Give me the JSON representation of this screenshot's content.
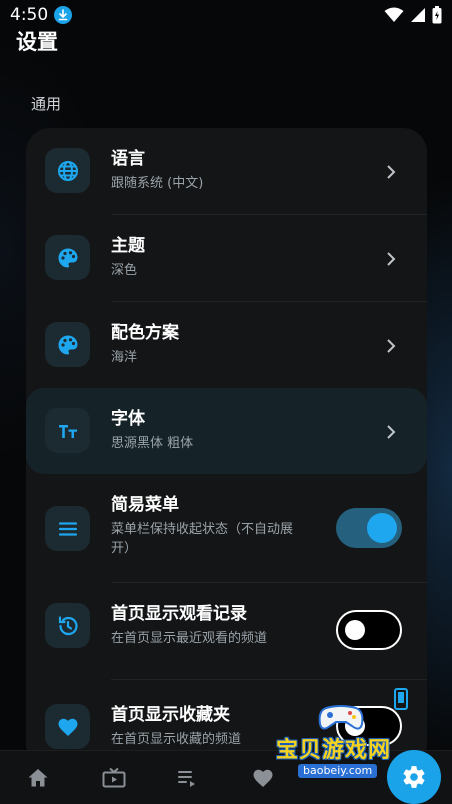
{
  "status_bar": {
    "time": "4:50",
    "icons": [
      "download-icon",
      "wifi-icon",
      "signal-icon",
      "battery-icon"
    ]
  },
  "page": {
    "title": "设置",
    "section_title": "通用"
  },
  "settings": {
    "language": {
      "label": "语言",
      "value": "跟随系统 (中文)",
      "icon": "globe-icon"
    },
    "theme": {
      "label": "主题",
      "value": "深色",
      "icon": "palette-icon"
    },
    "color_scheme": {
      "label": "配色方案",
      "value": "海洋",
      "icon": "palette-icon"
    },
    "font": {
      "label": "字体",
      "value": "思源黑体 粗体",
      "icon": "text-size-icon"
    },
    "simple_menu": {
      "label": "简易菜单",
      "value": "菜单栏保持收起状态（不自动展开）",
      "value_line1": "菜单栏保持收起状态（不自动展",
      "value_line2": "开）",
      "icon": "menu-icon",
      "enabled": true
    },
    "home_history": {
      "label": "首页显示观看记录",
      "value": "在首页显示最近观看的频道",
      "icon": "history-icon",
      "enabled": false
    },
    "home_favorites": {
      "label": "首页显示收藏夹",
      "value": "在首页显示收藏的频道",
      "icon": "heart-icon",
      "enabled": false
    }
  },
  "bottom_nav": {
    "items": [
      "home-icon",
      "tv-icon",
      "playlist-icon",
      "heart-icon"
    ],
    "active": "settings-gear-icon"
  },
  "watermark": {
    "text": "宝贝游戏网",
    "url": "baobeiy.com"
  },
  "colors": {
    "accent": "#1ba3e9",
    "card": "#131516",
    "highlight": "#152228",
    "background": "#060708"
  }
}
